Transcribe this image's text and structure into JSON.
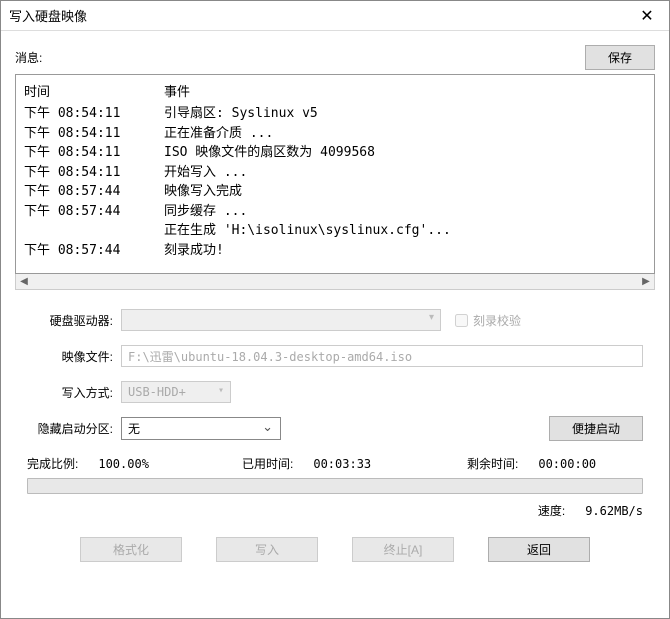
{
  "title": "写入硬盘映像",
  "msg_label": "消息:",
  "save_btn": "保存",
  "log_header": {
    "time": "时间",
    "event": "事件"
  },
  "log_rows": [
    {
      "time": "下午 08:54:11",
      "event": "引导扇区: Syslinux v5"
    },
    {
      "time": "下午 08:54:11",
      "event": "正在准备介质 ..."
    },
    {
      "time": "下午 08:54:11",
      "event": "ISO 映像文件的扇区数为 4099568"
    },
    {
      "time": "下午 08:54:11",
      "event": "开始写入 ..."
    },
    {
      "time": "下午 08:57:44",
      "event": "映像写入完成"
    },
    {
      "time": "下午 08:57:44",
      "event": "同步缓存 ..."
    },
    {
      "time": "",
      "event": "正在生成 'H:\\isolinux\\syslinux.cfg'..."
    },
    {
      "time": "下午 08:57:44",
      "event": "刻录成功!"
    }
  ],
  "form": {
    "drive_label": "硬盘驱动器:",
    "verify_label": "刻录校验",
    "image_label": "映像文件:",
    "image_path": "F:\\迅雷\\ubuntu-18.04.3-desktop-amd64.iso",
    "mode_label": "写入方式:",
    "mode_value": "USB-HDD+",
    "hide_label": "隐藏启动分区:",
    "hide_value": "无",
    "conv_btn": "便捷启动"
  },
  "stats": {
    "done_label": "完成比例:",
    "done_value": "100.00%",
    "elapsed_label": "已用时间:",
    "elapsed_value": "00:03:33",
    "remain_label": "剩余时间:",
    "remain_value": "00:00:00",
    "speed_label": "速度:",
    "speed_value": "9.62MB/s"
  },
  "actions": {
    "format": "格式化",
    "write": "写入",
    "abort": "终止[A]",
    "back": "返回"
  }
}
